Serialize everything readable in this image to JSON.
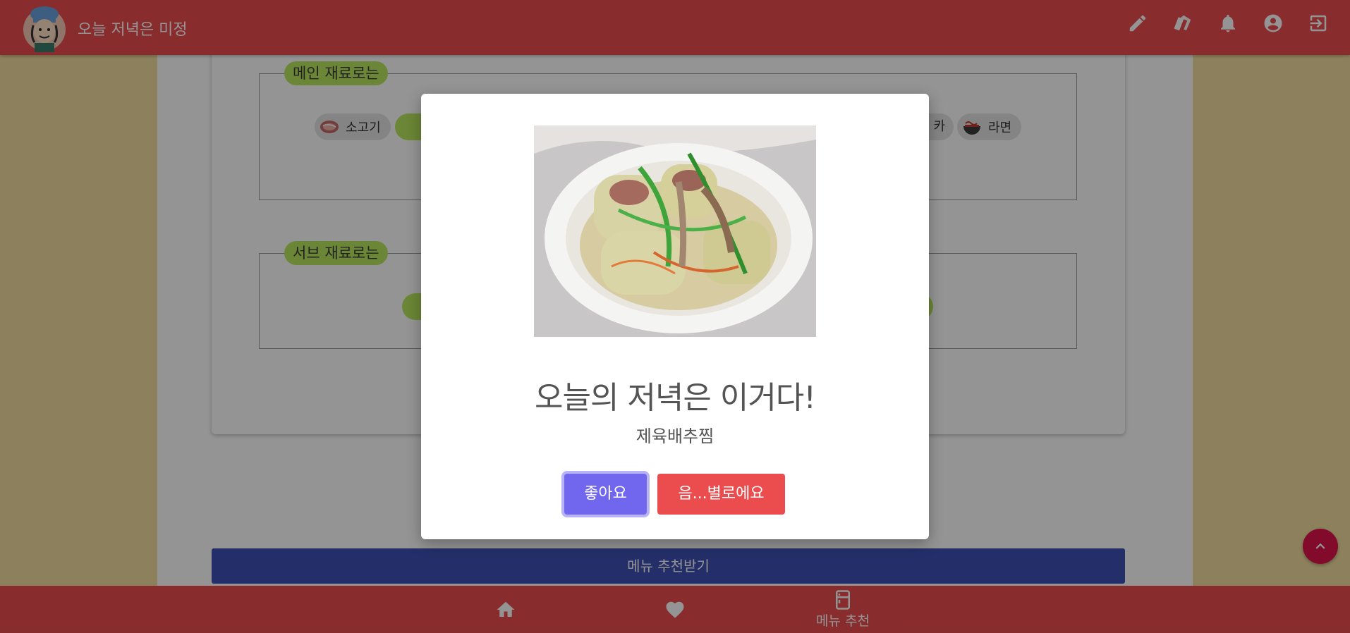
{
  "app": {
    "title": "오늘 저녁은 미정"
  },
  "appbar": {
    "icons": [
      "pencil-icon",
      "cards-icon",
      "bell-icon",
      "account-icon",
      "logout-icon"
    ]
  },
  "form": {
    "main_legend": "메인 재료로는",
    "sub_legend": "서브 재료로는",
    "main_chips": [
      {
        "label": "소고기",
        "icon": "beef-icon"
      },
      {
        "label": "카",
        "icon": ""
      },
      {
        "label": "라면",
        "icon": "ramen-icon"
      }
    ]
  },
  "recommend_button": "메뉴 추천받기",
  "bottom_nav": {
    "items": [
      {
        "icon": "home-icon",
        "label": ""
      },
      {
        "icon": "heart-icon",
        "label": ""
      },
      {
        "icon": "fridge-icon",
        "label": "메뉴 추천"
      }
    ]
  },
  "modal": {
    "title": "오늘의 저녁은 이거다!",
    "menu_name": "제육배추찜",
    "like_label": "좋아요",
    "dislike_label": "음...별로에요"
  },
  "colors": {
    "primary": "#eb4d4f",
    "like_button": "#7067ee",
    "legend_bg": "#b9e75e",
    "page_side": "#f3dfa0"
  }
}
